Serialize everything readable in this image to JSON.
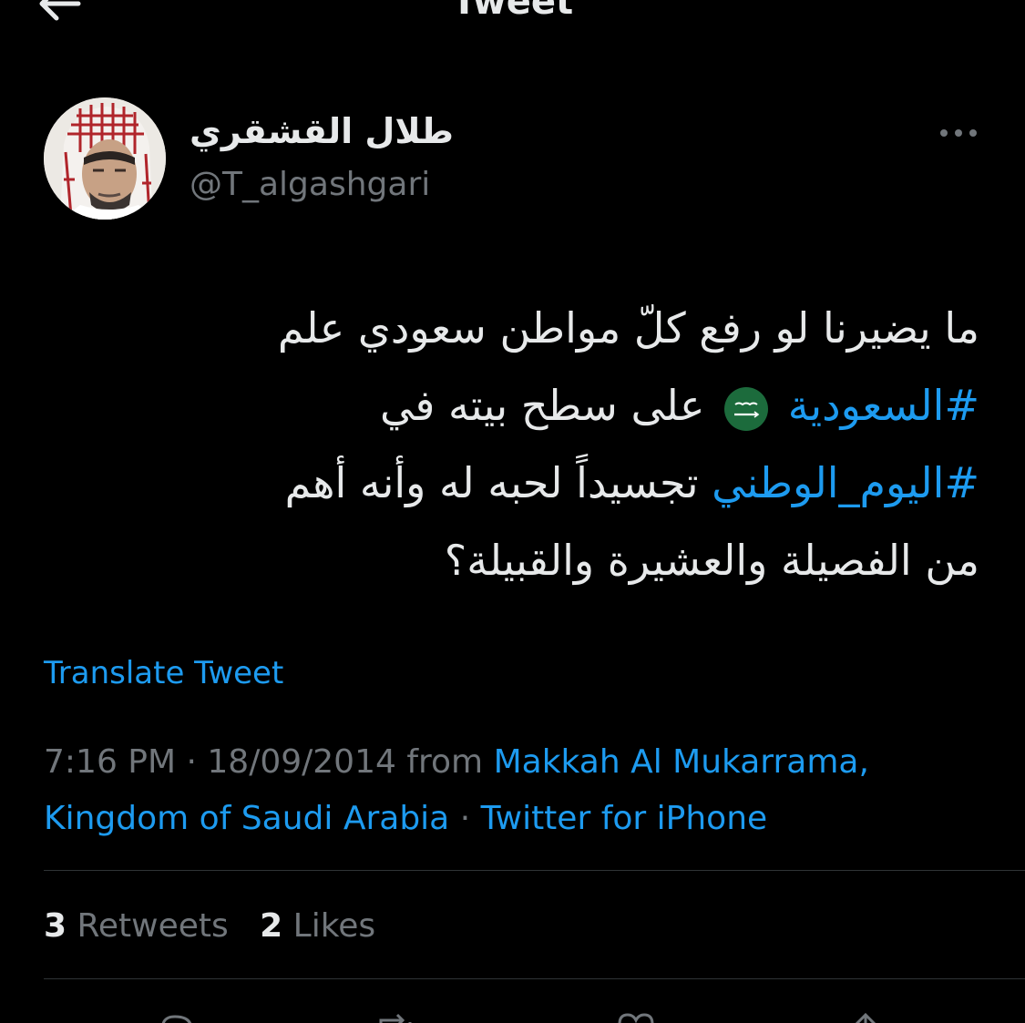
{
  "header": {
    "title": "Tweet"
  },
  "author": {
    "display_name": "طلال القشقري",
    "handle": "@T_algashgari"
  },
  "tweet": {
    "line1": "ما يضيرنا لو رفع كلّ مواطن سعودي علم",
    "line2_hashtag": "#السعودية",
    "line2_text": "على سطح بيته في",
    "line3_hashtag": "#اليوم_الوطني",
    "line3_text": "تجسيداً لحبه له وأنه أهم",
    "line4": "من الفصيلة والعشيرة والقبيلة؟"
  },
  "translate_label": "Translate Tweet",
  "meta": {
    "time": "7:16 PM",
    "sep1": " · ",
    "date": "18/09/2014",
    "from": " from ",
    "location_line1": "Makkah Al Mukarrama,",
    "location_line2": "Kingdom of Saudi Arabia",
    "sep2": " · ",
    "source": "Twitter for iPhone"
  },
  "stats": {
    "retweets_count": "3",
    "retweets_label": "Retweets",
    "likes_count": "2",
    "likes_label": "Likes"
  },
  "icons": {
    "back": "arrow-left-icon",
    "more": "ellipsis-icon",
    "flag": "saudi-flag-emoji",
    "reply": "reply-icon",
    "retweet": "retweet-icon",
    "like": "heart-icon",
    "share": "share-icon"
  },
  "colors": {
    "background": "#000000",
    "text_primary": "#E7E9EA",
    "text_secondary": "#71767B",
    "accent": "#1D9BF0",
    "divider": "#2F3336",
    "flag_green": "#1C6B3C"
  }
}
